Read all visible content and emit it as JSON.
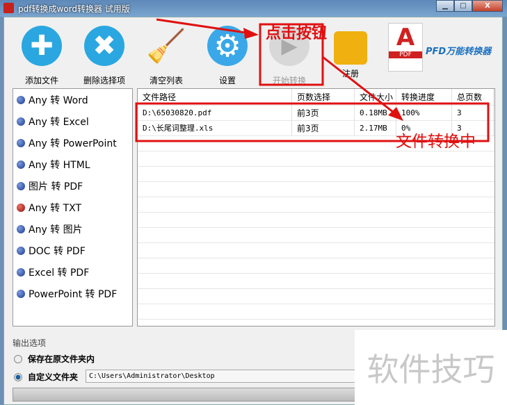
{
  "window": {
    "title": "pdf转换成word转换器 试用版",
    "buttons": [
      "▁",
      "□",
      "X"
    ]
  },
  "toolbar": [
    {
      "label": "添加文件",
      "icon": "plus-circle-icon",
      "color": "#2aa7e0"
    },
    {
      "label": "删除选择项",
      "icon": "x-circle-icon",
      "color": "#2aa7e0"
    },
    {
      "label": "清空列表",
      "icon": "broom-icon",
      "color": "#e8c020"
    },
    {
      "label": "设置",
      "icon": "gear-icon",
      "color": "#3aa8e8"
    },
    {
      "label": "开始转换",
      "icon": "play-icon",
      "color": "#c8c8c8"
    },
    {
      "label": "注册",
      "icon": "lock-icon",
      "color": "#f0b010"
    }
  ],
  "brand": {
    "text": "PFD万能转换器",
    "pdf_label": "PDF"
  },
  "formats": [
    {
      "label": "Any 转 Word",
      "active": false
    },
    {
      "label": "Any 转 Excel",
      "active": false
    },
    {
      "label": "Any 转 PowerPoint",
      "active": false
    },
    {
      "label": "Any 转 HTML",
      "active": false
    },
    {
      "label": "图片 转 PDF",
      "active": false
    },
    {
      "label": "Any 转 TXT",
      "active": true
    },
    {
      "label": "Any 转 图片",
      "active": false
    },
    {
      "label": "DOC 转 PDF",
      "active": false
    },
    {
      "label": "Excel 转 PDF",
      "active": false
    },
    {
      "label": "PowerPoint 转 PDF",
      "active": false
    }
  ],
  "table": {
    "headers": [
      "文件路径",
      "页数选择",
      "文件大小",
      "转换进度",
      "总页数"
    ],
    "rows": [
      [
        "D:\\65030820.pdf",
        "前3页",
        "0.18MB",
        "100%",
        "3"
      ],
      [
        "D:\\长尾词整理.xls",
        "前3页",
        "2.17MB",
        "0%",
        "3"
      ]
    ]
  },
  "output": {
    "title": "输出选项",
    "option1": "保存在原文件夹内",
    "option2": "自定义文件夹",
    "selected": "自定义文件夹",
    "path": "C:\\Users\\Administrator\\Desktop",
    "progress": 0
  },
  "annotations": {
    "click": "点击按钮",
    "converting": "文件转换中",
    "color": "#e01010"
  },
  "watermark": "软件技巧"
}
